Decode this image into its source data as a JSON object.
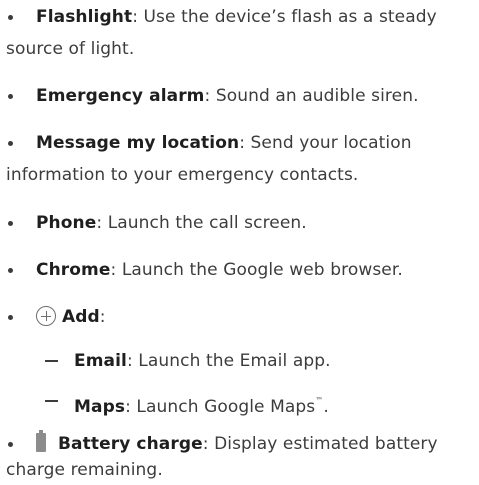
{
  "items": [
    {
      "term": "Flashlight",
      "desc": ": Use the device’s flash as a steady",
      "cont": "source of light."
    },
    {
      "term": "Emergency alarm",
      "desc": ": Sound an audible siren."
    },
    {
      "term": "Message my location",
      "desc": ": Send your location",
      "cont": "information to your emergency contacts."
    },
    {
      "term": "Phone",
      "desc": ": Launch the call screen."
    },
    {
      "term": "Chrome",
      "desc": ": Launch the Google web browser."
    },
    {
      "term": "Add",
      "desc": ":",
      "icon": "plus-circle-icon"
    },
    {
      "term": "Email",
      "desc": ": Launch the Email app."
    },
    {
      "term": "Maps",
      "desc": ": Launch Google Maps",
      "suffix_tm": "™",
      "suffix_end": "."
    },
    {
      "term": "Battery charge",
      "desc": ": Display estimated battery",
      "cont": "charge remaining.",
      "icon": "battery-icon"
    }
  ],
  "colors": {
    "text": "#3c3c3c",
    "term": "#1f1f1f",
    "icon": "#8c8c8c"
  }
}
